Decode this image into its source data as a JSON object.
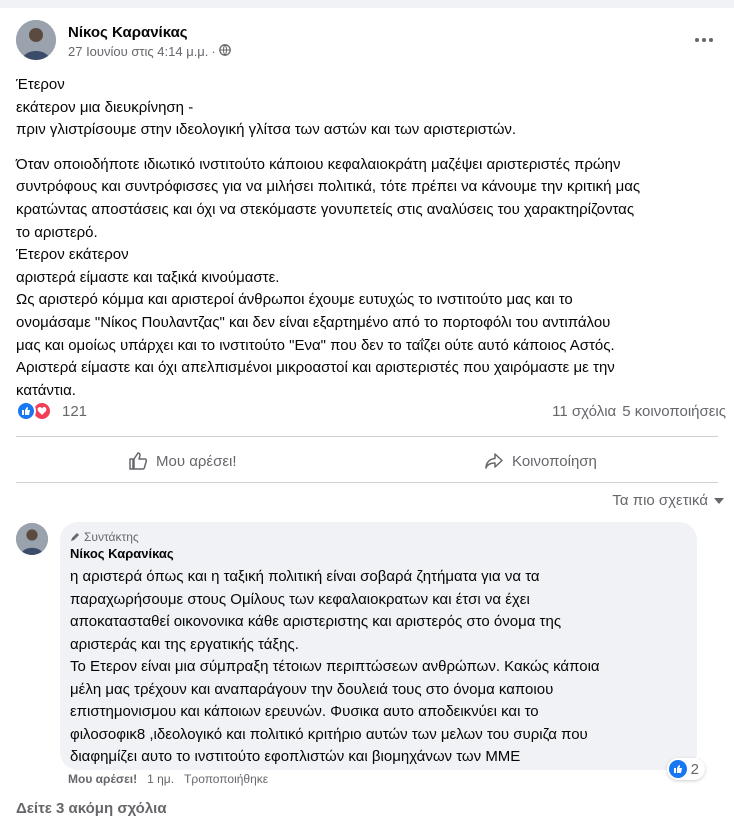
{
  "post": {
    "author": "Νίκος Καρανίκας",
    "date": "27 Ιουνίου στις 4:14 μ.μ.",
    "separator": "·",
    "body_lines_1": [
      "Έτερον",
      "εκάτερον μια διευκρίνηση -",
      "πριν γλιστρίσουμε στην ιδεολογική γλίτσα των αστών και των αριστεριστών."
    ],
    "body_lines_2": [
      "Όταν οποιοδήποτε ιδιωτικό ινστιτούτο κάποιου  κεφαλαιοκράτη μαζέψει αριστεριστές πρώην",
      "συντρόφους και συντρόφισσες για να μιλήσει πολιτικά, τότε πρέπει να κάνουμε την κριτική μας",
      "κρατώντας αποστάσεις και όχι να στεκόμαστε γονυπετείς στις αναλύσεις του χαρακτηρίζοντας",
      "το αριστερό.",
      "Έτερον εκάτερον",
      "αριστερά είμαστε και ταξικά κινούμαστε.",
      "Ως αριστερό κόμμα και αριστεροί άνθρωποι έχουμε ευτυχώς το ινστιτούτο μας και το",
      "ονομάσαμε \"Νίκος Πουλαντζας\" και δεν είναι εξαρτημένο από το πορτοφόλι του αντιπάλου",
      "μας και ομοίως υπάρχει και το ινστιτούτο \"Ενα\"  που δεν το ταΐζει ούτε αυτό κάποιος Αστός.",
      "Αριστερά είμαστε και όχι απελπισμένοι μικροαστοί και αριστεριστές που χαιρόμαστε με την",
      "κατάντια."
    ]
  },
  "stats": {
    "reaction_count": "121",
    "comments": "11 σχόλια",
    "shares": "5 κοινοποιήσεις"
  },
  "actions": {
    "like": "Μου αρέσει!",
    "share": "Κοινοποίηση"
  },
  "sort_label": "Τα πιο σχετικά",
  "comment": {
    "badge": "Συντάκτης",
    "author": "Νίκος Καρανίκας",
    "lines": [
      "η αριστερά όπως και η ταξική πολιτική είναι σοβαρά ζητήματα για να τα",
      "παραχωρήσουμε στους Ομίλους των κεφαλαιοκρατων και έτσι να έχει",
      "αποκατασταθεί οικονονικα κάθε αριστεριστης και αριστερός στο όνομα της",
      "αριστεράς και της εργατικής τάξης.",
      "Το Ετερον είναι μια σύμπραξη τέτοιων περιπτώσεων ανθρώπων. Κακώς κάποια",
      "μέλη μας τρέχουν και αναπαράγουν την δουλειά τους στο όνομα καποιου",
      "επιστημονισμου και κάποιων ερευνών. Φυσικα αυτο αποδεικνύει και το",
      "φιλοσοφικ8 ,ιδεολογικό και πολιτικό κριτήριο αυτών των μελων του συριζα που",
      "διαφημίζει αυτο το ινστιτούτο εφοπλιστών και βιομηχάνων των ΜΜΕ"
    ],
    "reaction_count": "2",
    "like_label": "Μου αρέσει!",
    "time": "1 ημ.",
    "edited": "Τροποποιήθηκε"
  },
  "more_comments": "Δείτε 3 ακόμη σχόλια",
  "colors": {
    "like_blue": "#1877f2",
    "love_red": "#f33e58",
    "secondary_text": "#65676b"
  }
}
